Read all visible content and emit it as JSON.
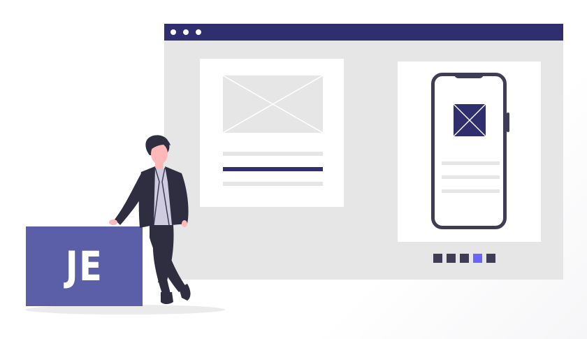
{
  "logo": {
    "text": "JE"
  },
  "colors": {
    "navy": "#2f2e6e",
    "dark": "#3f3d56",
    "accent": "#6c63ff",
    "block": "#5a5fa8",
    "placeholder": "#e6e6e6"
  },
  "icons": [
    "window-dots-icon",
    "image-placeholder-icon",
    "phone-icon",
    "person-illustration"
  ],
  "pager": {
    "count": 5,
    "active_index": 3
  }
}
